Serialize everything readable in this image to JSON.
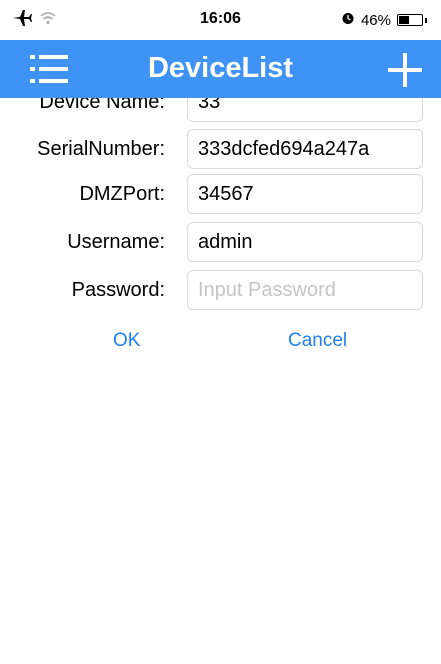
{
  "status_bar": {
    "time": "16:06",
    "battery_percent_text": "46%",
    "battery_level": 0.46,
    "icons": [
      "airplane-icon",
      "wifi-icon",
      "alarm-icon",
      "battery-icon"
    ]
  },
  "nav": {
    "title": "DeviceList",
    "menu_icon": "hamburger-menu-icon",
    "add_icon": "plus-icon",
    "background_color": "#3f93f4"
  },
  "form": {
    "fields": [
      {
        "label": "Device Name:",
        "value": "33",
        "placeholder": ""
      },
      {
        "label": "SerialNumber:",
        "value": "333dcfed694a247a",
        "placeholder": ""
      },
      {
        "label": "DMZPort:",
        "value": "34567",
        "placeholder": ""
      },
      {
        "label": "Username:",
        "value": "admin",
        "placeholder": ""
      },
      {
        "label": "Password:",
        "value": "",
        "placeholder": "Input Password"
      }
    ],
    "ok_label": "OK",
    "cancel_label": "Cancel",
    "accent_color": "#1e7ff3"
  }
}
